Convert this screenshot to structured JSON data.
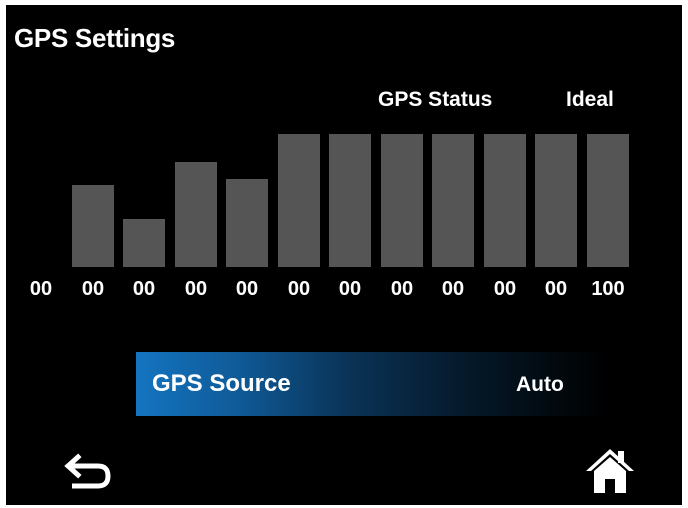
{
  "header": {
    "title": "GPS Settings"
  },
  "status": {
    "label": "GPS Status",
    "value": "Ideal"
  },
  "signal_bars": {
    "levels": [
      0,
      0.48,
      0.28,
      0.62,
      0.52,
      0.78,
      0.78,
      0.78,
      0.78,
      0.78,
      0.78,
      0.78
    ],
    "labels": [
      "00",
      "00",
      "00",
      "00",
      "00",
      "00",
      "00",
      "00",
      "00",
      "00",
      "00",
      "100"
    ],
    "bar_color": "#555555"
  },
  "source": {
    "label": "GPS Source",
    "value": "Auto",
    "accent": "#1474c0"
  },
  "nav": {
    "back_icon": "back-arrow-icon",
    "home_icon": "home-icon"
  }
}
